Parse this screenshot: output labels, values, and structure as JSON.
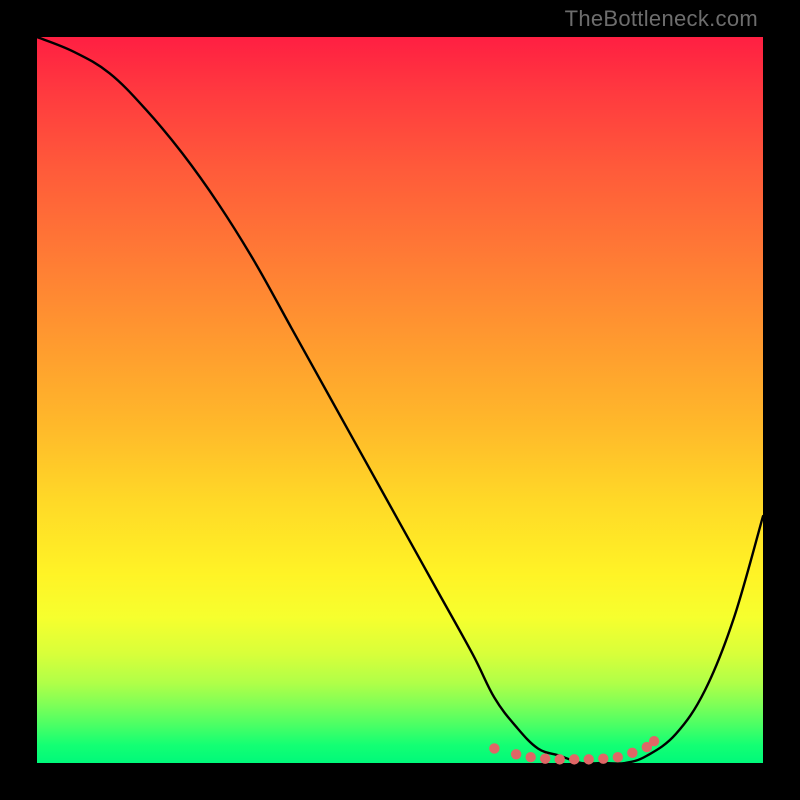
{
  "watermark": "TheBottleneck.com",
  "chart_data": {
    "type": "line",
    "title": "",
    "xlabel": "",
    "ylabel": "",
    "xlim": [
      0,
      100
    ],
    "ylim": [
      0,
      100
    ],
    "grid": false,
    "legend": false,
    "background": "rainbow-vertical",
    "series": [
      {
        "name": "bottleneck-curve",
        "x": [
          0,
          5,
          10,
          15,
          20,
          25,
          30,
          35,
          40,
          45,
          50,
          55,
          60,
          63,
          66,
          69,
          72,
          75,
          78,
          81,
          84,
          88,
          92,
          96,
          100
        ],
        "y": [
          100,
          98,
          95,
          90,
          84,
          77,
          69,
          60,
          51,
          42,
          33,
          24,
          15,
          9,
          5,
          2,
          1,
          0,
          0,
          0,
          1,
          4,
          10,
          20,
          34
        ]
      }
    ],
    "markers": {
      "name": "optimal-range",
      "color": "#e06666",
      "points": [
        {
          "x": 63,
          "y": 2.0
        },
        {
          "x": 66,
          "y": 1.2
        },
        {
          "x": 68,
          "y": 0.8
        },
        {
          "x": 70,
          "y": 0.6
        },
        {
          "x": 72,
          "y": 0.5
        },
        {
          "x": 74,
          "y": 0.5
        },
        {
          "x": 76,
          "y": 0.5
        },
        {
          "x": 78,
          "y": 0.6
        },
        {
          "x": 80,
          "y": 0.8
        },
        {
          "x": 82,
          "y": 1.4
        },
        {
          "x": 84,
          "y": 2.2
        },
        {
          "x": 85,
          "y": 3.0
        }
      ]
    }
  }
}
